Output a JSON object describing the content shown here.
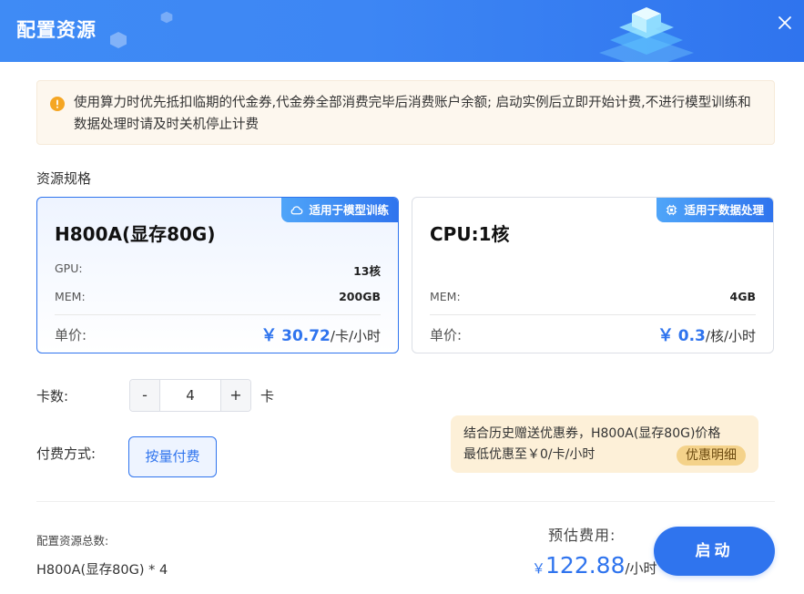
{
  "header": {
    "title": "配置资源"
  },
  "notice": {
    "text": "使用算力时优先抵扣临期的代金券,代金券全部消费完毕后消费账户余额; 启动实例后立即开始计费,不进行模型训练和数据处理时请及时关机停止计费"
  },
  "spec_section": {
    "label": "资源规格"
  },
  "cards": [
    {
      "badge": "适用于模型训练",
      "name": "H800A(显存80G)",
      "gpu_label": "GPU:",
      "gpu_value": "13核",
      "mem_label": "MEM:",
      "mem_value": "200GB",
      "price_label": "单价:",
      "price_currency": "￥",
      "price_value": "30.72",
      "price_unit": "/卡/小时",
      "selected": true
    },
    {
      "badge": "适用于数据处理",
      "name": "CPU:1核",
      "mem_label": "MEM:",
      "mem_value": "4GB",
      "price_label": "单价:",
      "price_currency": "￥",
      "price_value": "0.3",
      "price_unit": "/核/小时",
      "selected": false
    }
  ],
  "quantity": {
    "label": "卡数:",
    "minus": "-",
    "value": "4",
    "plus": "+",
    "unit": "卡"
  },
  "payment": {
    "label": "付费方式:",
    "option": "按量付费"
  },
  "coupon": {
    "line1": "结合历史赠送优惠券，H800A(显存80G)价格",
    "line2": "最低优惠至￥0/卡/小时",
    "detail_label": "优惠明细"
  },
  "footer": {
    "summary_label": "配置资源总数:",
    "summary_value": "H800A(显存80G) * 4",
    "estimate_label": "预估费用:",
    "estimate_currency": "￥",
    "estimate_value": "122.88",
    "estimate_unit": "/小时",
    "start_label": "启动"
  },
  "colors": {
    "accent": "#2f74ee",
    "warning": "#f5a623"
  }
}
